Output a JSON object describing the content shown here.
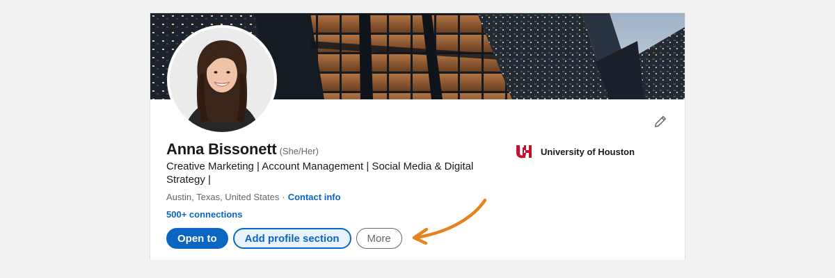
{
  "profile": {
    "name": "Anna Bissonett",
    "pronouns": "(She/Her)",
    "headline": "Creative Marketing | Account Management | Social Media & Digital Strategy |",
    "location": "Austin, Texas, United States",
    "separator": "·",
    "contact_info_label": "Contact info",
    "connections": "500+ connections"
  },
  "actions": {
    "open_to_label": "Open to",
    "add_section_label": "Add profile section",
    "more_label": "More"
  },
  "education": {
    "school_name": "University of Houston",
    "logo_icon": "university-of-houston-logo"
  },
  "icons": {
    "edit": "pencil-icon"
  },
  "colors": {
    "primary": "#0a66c2",
    "secondary_bg": "#e8f3ff",
    "text": "#191919",
    "muted": "#666666",
    "annotation_arrow": "#e8821e",
    "school_red": "#c8102e"
  }
}
